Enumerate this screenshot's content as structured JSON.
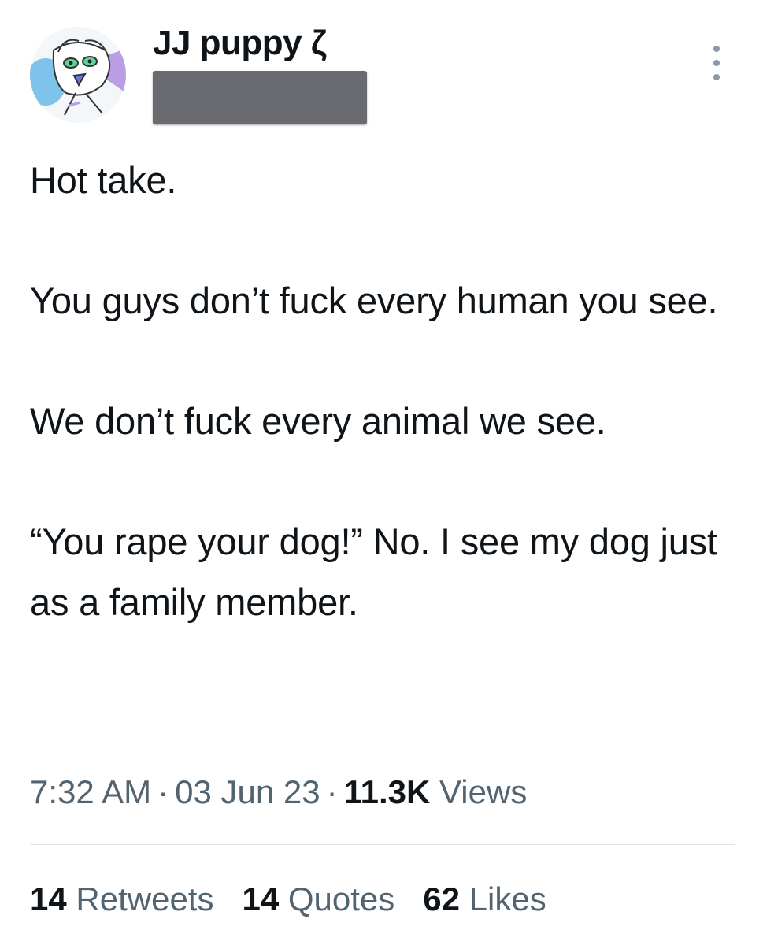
{
  "author": {
    "display_name": "JJ puppy ζ",
    "avatar_icon": "dog-avatar-icon",
    "handle_redacted": true
  },
  "tweet": {
    "paragraphs": [
      "Hot take.",
      "You guys don’t fuck every human you see.",
      "We don’t fuck every animal we see.",
      "“You rape your dog!” No. I see my dog just as a family member."
    ],
    "time": "7:32 AM",
    "date": "03 Jun 23",
    "separator": "·",
    "views_count": "11.3K",
    "views_label": "Views"
  },
  "stats": {
    "retweets_count": "14",
    "retweets_label": "Retweets",
    "quotes_count": "14",
    "quotes_label": "Quotes",
    "likes_count": "62",
    "likes_label": "Likes"
  },
  "colors": {
    "text_primary": "#0f1419",
    "text_secondary": "#536471",
    "divider": "#dfe4e8",
    "redaction": "#6a6b70"
  }
}
